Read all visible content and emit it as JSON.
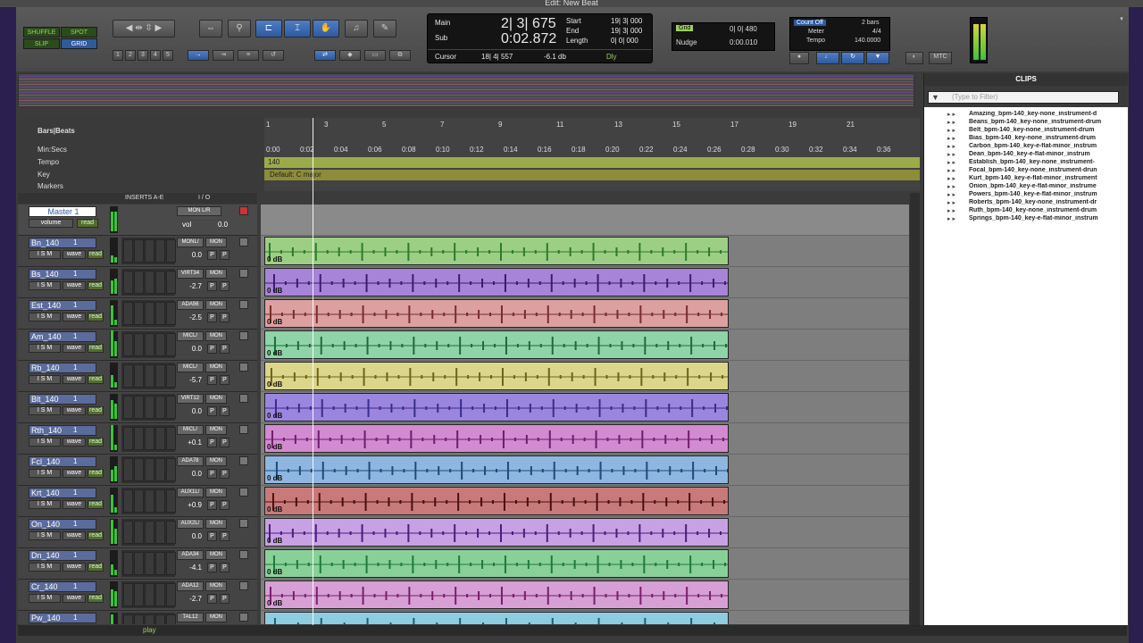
{
  "window": {
    "title": "Edit: New Beat"
  },
  "modes": {
    "shuffle": "SHUFFLE",
    "spot": "SPOT",
    "slip": "SLIP",
    "grid": "GRID"
  },
  "toolbar": {
    "zoom_presets": [
      "1",
      "2",
      "3",
      "4",
      "5"
    ]
  },
  "counter": {
    "main_label": "Main",
    "main_value": "2| 3| 675",
    "sub_label": "Sub",
    "sub_value": "0:02.872",
    "start_label": "Start",
    "start_value": "19| 3| 000",
    "end_label": "End",
    "end_value": "19| 3| 000",
    "length_label": "Length",
    "length_value": "0| 0| 000",
    "cursor_label": "Cursor",
    "cursor_value": "18| 4| 557",
    "db_value": "-6.1 db",
    "dly_label": "Dly"
  },
  "grid": {
    "grid_label": "Grid",
    "grid_value": "0| 0| 480",
    "nudge_label": "Nudge",
    "nudge_value": "0:00.010"
  },
  "count": {
    "countoff_label": "Count Off",
    "countoff_value": "2 bars",
    "meter_label": "Meter",
    "meter_value": "4/4",
    "tempo_label": "Tempo",
    "tempo_value": "140.0000"
  },
  "mtc": "MTC",
  "rulers": {
    "barsbeats_label": "Bars|Beats",
    "minsecs_label": "Min:Secs",
    "tempo_label": "Tempo",
    "key_label": "Key",
    "markers_label": "Markers",
    "bars": [
      "1",
      "3",
      "5",
      "7",
      "9",
      "11",
      "13",
      "15",
      "17",
      "19",
      "21"
    ],
    "secs": [
      "0:00",
      "0:02",
      "0:04",
      "0:06",
      "0:08",
      "0:10",
      "0:12",
      "0:14",
      "0:16",
      "0:18",
      "0:20",
      "0:22",
      "0:24",
      "0:26",
      "0:28",
      "0:30",
      "0:32",
      "0:34",
      "0:36"
    ],
    "tempo_value": "140",
    "key_value": "Default: C major"
  },
  "tracklist_header": {
    "inserts": "INSERTS A-E",
    "io": "I / O"
  },
  "master": {
    "name": "Master 1",
    "view": "volume",
    "mode": "read",
    "io": "MON L/R",
    "vol_label": "vol",
    "vol_value": "0.0"
  },
  "tracks": [
    {
      "name": "Bn_140",
      "io": "MONL/",
      "mon": "MON",
      "vol": "0.0",
      "color": "#9ccf84",
      "wave": "#2c7a2c"
    },
    {
      "name": "Bs_140",
      "io": "VIRT34",
      "mon": "MON",
      "vol": "-2.7",
      "color": "#a784d8",
      "wave": "#3a1d6e"
    },
    {
      "name": "Est_140",
      "io": "ADA56",
      "mon": "MON",
      "vol": "-2.5",
      "color": "#dca0a0",
      "wave": "#7a2c2c"
    },
    {
      "name": "Am_140",
      "io": "MICL/",
      "mon": "MON",
      "vol": "0.0",
      "color": "#8fd4a8",
      "wave": "#1e6b3a"
    },
    {
      "name": "Rb_140",
      "io": "MICL/",
      "mon": "MON",
      "vol": "-5.7",
      "color": "#dcd68a",
      "wave": "#6b641e"
    },
    {
      "name": "Blt_140",
      "io": "VIRT12",
      "mon": "MON",
      "vol": "0.0",
      "color": "#9a86de",
      "wave": "#3a2c8a"
    },
    {
      "name": "Rth_140",
      "io": "MICL/",
      "mon": "MON",
      "vol": "+0.1",
      "color": "#d28ad0",
      "wave": "#6e1e6b"
    },
    {
      "name": "Fcl_140",
      "io": "ADA78",
      "mon": "MON",
      "vol": "0.0",
      "color": "#8eb6e0",
      "wave": "#1e4a7a"
    },
    {
      "name": "Krt_140",
      "io": "AUX1L/",
      "mon": "MON",
      "vol": "+0.9",
      "color": "#c87a7a",
      "wave": "#4a0e0e"
    },
    {
      "name": "On_140",
      "io": "AUX2L/",
      "mon": "MON",
      "vol": "0.0",
      "color": "#c8a0e4",
      "wave": "#4a1e7a"
    },
    {
      "name": "Dn_140",
      "io": "ADA34",
      "mon": "MON",
      "vol": "-4.1",
      "color": "#88d098",
      "wave": "#1e7a3a"
    },
    {
      "name": "Cr_140",
      "io": "ADA12",
      "mon": "MON",
      "vol": "-2.7",
      "color": "#d6a0d4",
      "wave": "#7a1e6e"
    },
    {
      "name": "Pw_140",
      "io": "TAL12",
      "mon": "MON",
      "vol": "",
      "color": "#8ecce0",
      "wave": "#1e5a7a"
    }
  ],
  "track_controls": {
    "i": "I",
    "s": "S",
    "m": "M",
    "wave": "wave",
    "read": "read",
    "p": "P",
    "num": "1"
  },
  "clip_gain": "0 dB",
  "clips_panel": {
    "title": "CLIPS",
    "filter_placeholder": "(Type to Filter)",
    "items": [
      "Amazing_bpm-140_key-none_instrument-d",
      "Beans_bpm-140_key-none_instrument-drum",
      "Belt_bpm-140_key-none_instrument-drum",
      "Bias_bpm-140_key-none_instrument-drum",
      "Carbon_bpm-140_key-e-flat-minor_instrum",
      "Dean_bpm-140_key-e-flat-minor_instrum",
      "Establish_bpm-140_key-none_instrument-",
      "Focal_bpm-140_key-none_instrument-drun",
      "Kurt_bpm-140_key-e-flat-minor_instrument",
      "Onion_bpm-140_key-e-flat-minor_instrume",
      "Powers_bpm-140_key-e-flat-minor_instrum",
      "Roberts_bpm-140_key-none_instrument-dr",
      "Ruth_bpm-140_key-none_instrument-drum",
      "Springs_bpm-140_key-e-flat-minor_instrum"
    ]
  },
  "status": {
    "play": "play"
  },
  "colors": {
    "accent": "#4f7ec7",
    "mode_green": "#9dd05a",
    "counter_bg": "#141414"
  }
}
